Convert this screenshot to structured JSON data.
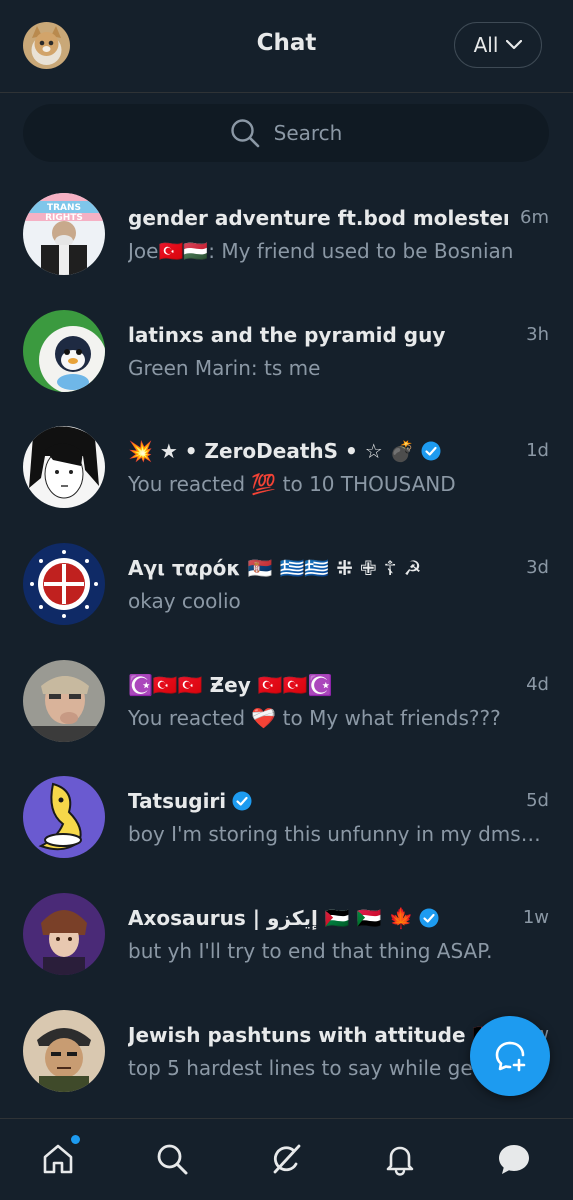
{
  "header": {
    "title": "Chat",
    "filter_label": "All"
  },
  "search": {
    "placeholder": "Search"
  },
  "chats": [
    {
      "name": "gender adventure ft.bod molester",
      "time": "6m",
      "preview": "Joe🇹🇷🇭🇺: My friend used to be Bosnian",
      "verified": false,
      "avatar_icon": "group-photo-avatar"
    },
    {
      "name": "latinxs and the pyramid guy",
      "time": "3h",
      "preview": "Green Marin: ts me",
      "verified": false,
      "avatar_icon": "penguin-plush-avatar"
    },
    {
      "name": "💥 ★ • ZeroDeathS • ☆ 💣",
      "time": "1d",
      "preview": "You reacted 💯 to 10 THOUSAND",
      "verified": true,
      "avatar_icon": "anime-boy-avatar"
    },
    {
      "name": "Αγι ταρόκ 🇷🇸 🇬🇷🇬🇷 ⁜ ✙ ☦ ☭",
      "time": "3d",
      "preview": "okay coolio",
      "verified": false,
      "avatar_icon": "emblem-avatar"
    },
    {
      "name": "☪️🇹🇷🇹🇷 Ƶey 🇹🇷🇹🇷☪️",
      "time": "4d",
      "preview": "You reacted ❤️‍🩹 to My what friends???",
      "verified": false,
      "avatar_icon": "person-photo-avatar"
    },
    {
      "name": "Tatsugiri",
      "time": "5d",
      "preview": "boy I'm storing this unfunny in my dms u...",
      "verified": true,
      "avatar_icon": "tatsugiri-avatar"
    },
    {
      "name": "Axosaurus | إيكزو 🇵🇸 🇸🇩 🍁",
      "time": "1w",
      "preview": "but yh I'll try to end that thing ASAP.",
      "verified": true,
      "avatar_icon": "anime-character-avatar"
    },
    {
      "name": "Jewish pashtuns with attitude 🇦🇫",
      "time": "1w",
      "preview": "top 5 hardest lines to say while get",
      "verified": false,
      "avatar_icon": "cartoon-soldier-avatar"
    }
  ],
  "colors": {
    "background": "#15202b",
    "accent": "#1d9bf0",
    "secondary_text": "#8b98a5"
  },
  "nav": {
    "items": [
      "home-icon",
      "search-icon",
      "grok-icon",
      "notifications-icon",
      "messages-icon"
    ]
  }
}
